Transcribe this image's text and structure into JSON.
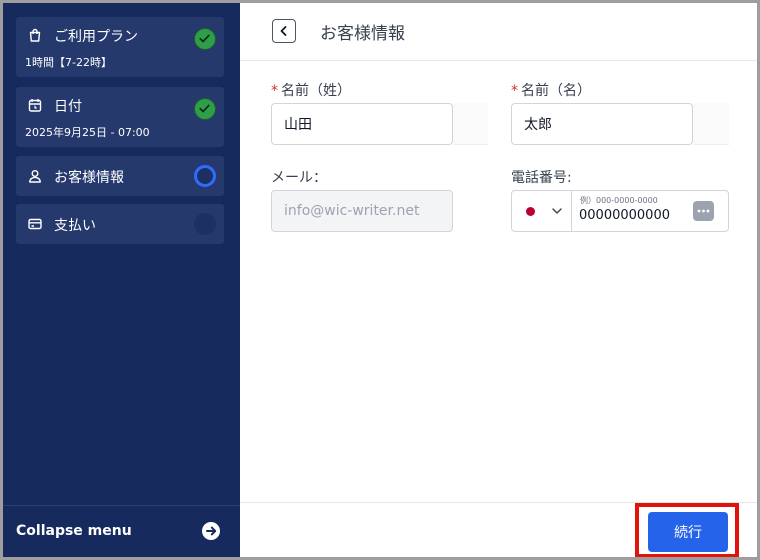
{
  "sidebar": {
    "steps": [
      {
        "title": "ご利用プラン",
        "subtitle": "1時間【7-22時】",
        "status": "done",
        "icon": "bag-icon"
      },
      {
        "title": "日付",
        "subtitle": "2025年9月25日 - 07:00",
        "status": "done",
        "icon": "calendar-icon"
      },
      {
        "title": "お客様情報",
        "subtitle": "",
        "status": "current",
        "icon": "user-icon"
      },
      {
        "title": "支払い",
        "subtitle": "",
        "status": "todo",
        "icon": "credit-card-icon"
      }
    ],
    "collapse_label": "Collapse menu"
  },
  "header": {
    "title": "お客様情報"
  },
  "form": {
    "last_name": {
      "label": "名前（姓）",
      "required": "*",
      "value": "山田"
    },
    "first_name": {
      "label": "名前（名）",
      "required": "*",
      "value": "太郎"
    },
    "email": {
      "label": "メール：",
      "placeholder": "info@wic-writer.net"
    },
    "phone": {
      "label": "電話番号:",
      "hint": "例）000-0000-0000",
      "value": "00000000000",
      "country": "jp-flag-icon"
    }
  },
  "footer": {
    "continue_label": "続行"
  },
  "colors": {
    "sidebar_bg": "#172a5e",
    "step_bg": "#25396d",
    "done": "#2e9e49",
    "current": "#2f6bff",
    "primary": "#2563eb",
    "highlight": "#e0140c"
  }
}
